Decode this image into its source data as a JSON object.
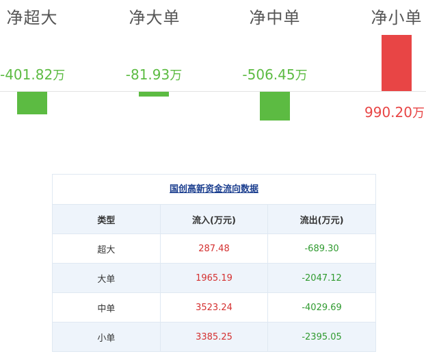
{
  "flow": {
    "categories": [
      {
        "label": "净超大",
        "value": -401.82,
        "display": "-401.82",
        "unit": "万"
      },
      {
        "label": "净大单",
        "value": -81.93,
        "display": "-81.93",
        "unit": "万"
      },
      {
        "label": "净中单",
        "value": -506.45,
        "display": "-506.45",
        "unit": "万"
      },
      {
        "label": "净小单",
        "value": 990.2,
        "display": "990.20",
        "unit": "万"
      }
    ],
    "colors": {
      "positive": "#e84545",
      "negative": "#5cbb42",
      "positive_text": "#e84545",
      "negative_text": "#5cbb42"
    }
  },
  "table": {
    "title": "国创高新资金流向数据",
    "headers": [
      "类型",
      "流入(万元)",
      "流出(万元)"
    ],
    "rows": [
      {
        "type": "超大",
        "inflow": "287.48",
        "outflow": "-689.30"
      },
      {
        "type": "大单",
        "inflow": "1965.19",
        "outflow": "-2047.12"
      },
      {
        "type": "中单",
        "inflow": "3523.24",
        "outflow": "-4029.69"
      },
      {
        "type": "小单",
        "inflow": "3385.25",
        "outflow": "-2395.05"
      }
    ]
  }
}
